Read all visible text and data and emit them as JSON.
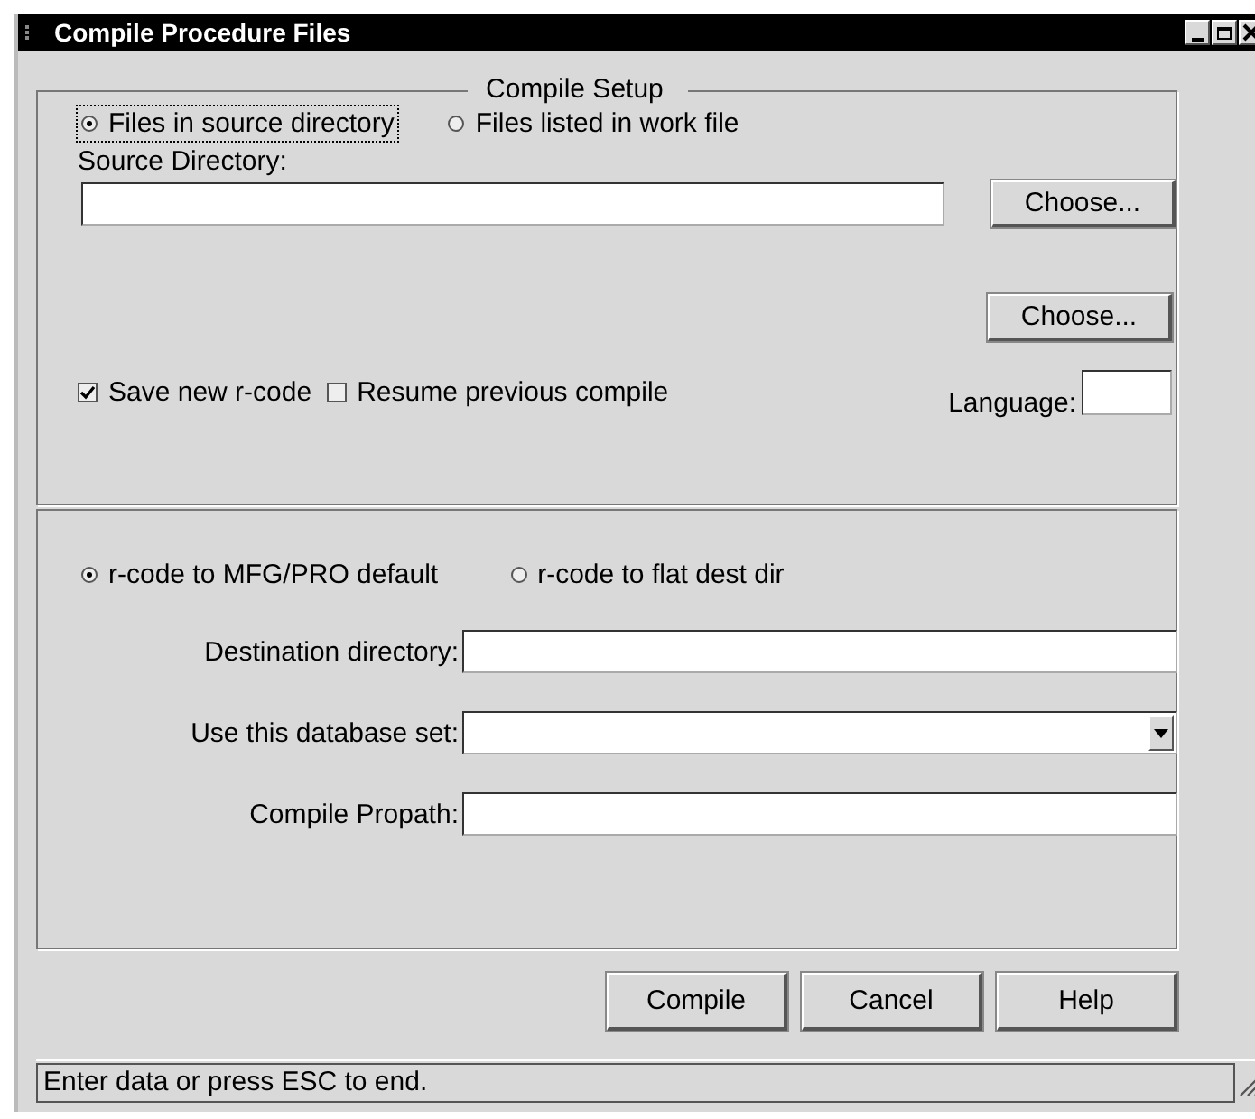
{
  "window": {
    "title": "Compile Procedure Files"
  },
  "compile_setup": {
    "title": "Compile Setup",
    "source_options": [
      {
        "label": "Files in source directory",
        "selected": true
      },
      {
        "label": "Files listed in work file",
        "selected": false
      }
    ],
    "source_directory": {
      "label": "Source Directory:"
    },
    "choose_buttons": [
      "Choose...",
      "Choose..."
    ],
    "checkboxes": [
      {
        "label": "Save new r-code",
        "checked": true
      },
      {
        "label": "Resume previous compile",
        "checked": false
      }
    ],
    "language": {
      "label": "Language:"
    }
  },
  "output": {
    "rcode_options": [
      {
        "label": "r-code to MFG/PRO default",
        "selected": true
      },
      {
        "label": "r-code to flat dest dir",
        "selected": false
      }
    ],
    "fields": [
      {
        "label": "Destination directory:",
        "kind": "text"
      },
      {
        "label": "Use this database set:",
        "kind": "dropdown"
      },
      {
        "label": "Compile Propath:",
        "kind": "text"
      }
    ]
  },
  "buttons": [
    "Compile",
    "Cancel",
    "Help"
  ],
  "status_bar": "Enter data or press ESC to end."
}
